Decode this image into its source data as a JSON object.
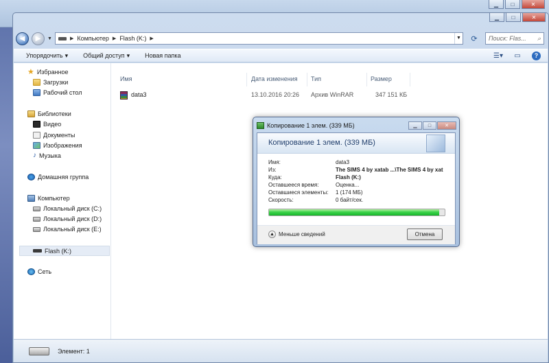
{
  "bg_window": {
    "minimize": "▁",
    "maximize": "□",
    "close": "✕"
  },
  "window": {
    "minimize": "▁",
    "maximize": "□",
    "close": "✕"
  },
  "address_bar": {
    "crumbs": [
      "Компьютер",
      "Flash (K:)"
    ],
    "search_placeholder": "Поиск: Flas..."
  },
  "toolbar": {
    "organize": "Упорядочить",
    "share": "Общий доступ",
    "new_folder": "Новая папка"
  },
  "nav": {
    "favorites": "Избранное",
    "downloads": "Загрузки",
    "desktop": "Рабочий стол",
    "libraries": "Библиотеки",
    "video": "Видео",
    "documents": "Документы",
    "images": "Изображения",
    "music": "Музыка",
    "homegroup": "Домашняя группа",
    "computer": "Компьютер",
    "disk_c": "Локальный диск (C:)",
    "disk_d": "Локальный диск (D:)",
    "disk_e": "Локальный диск (E:)",
    "flash": "Flash (K:)",
    "network": "Сеть"
  },
  "columns": {
    "name": "Имя",
    "date": "Дата изменения",
    "type": "Тип",
    "size": "Размер"
  },
  "files": [
    {
      "name": "data3",
      "date": "13.10.2016 20:26",
      "type": "Архив WinRAR",
      "size": "347 151 КБ"
    }
  ],
  "status": {
    "text": "Элемент: 1"
  },
  "dialog": {
    "title": "Копирование 1 элем. (339 МБ)",
    "header": "Копирование 1 элем. (339 МБ)",
    "name_label": "Имя:",
    "name_value": "data3",
    "from_label": "Из:",
    "from_value": "The SIMS 4 by xatab ...\\The SIMS 4 by xat",
    "to_label": "Куда:",
    "to_value": "Flash (K:)",
    "time_label": "Оставшееся время:",
    "time_value": "Оценка...",
    "items_label": "Оставшиеся элементы:",
    "items_value": "1 (174 МБ)",
    "speed_label": "Скорость:",
    "speed_value": "0 байт/сек.",
    "progress_percent": 97,
    "less_details": "Меньше сведений",
    "cancel": "Отмена"
  }
}
